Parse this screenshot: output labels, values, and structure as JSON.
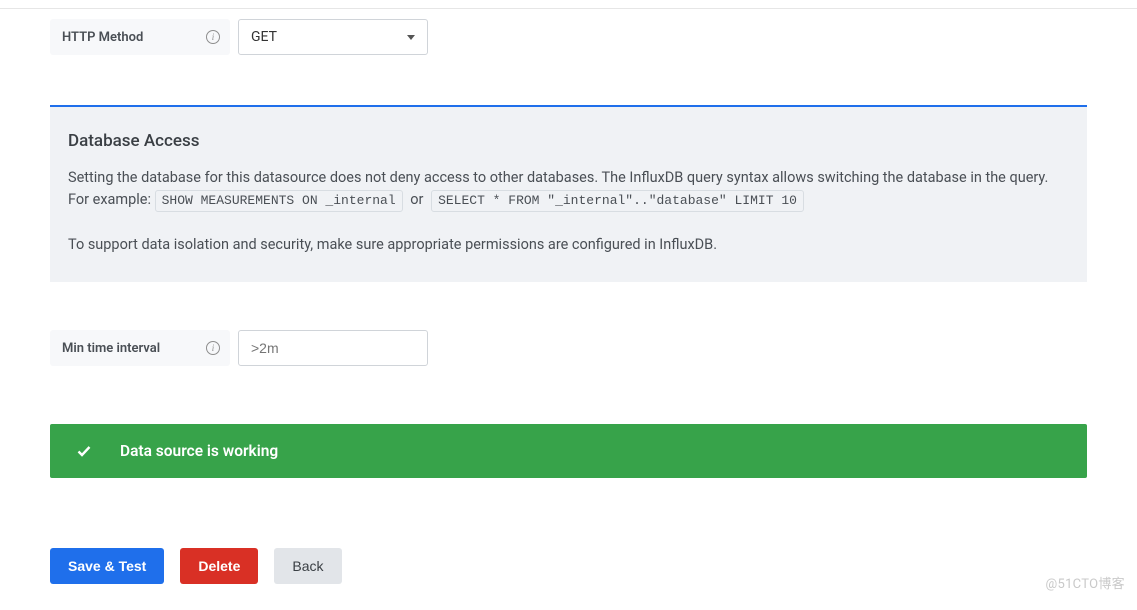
{
  "httpMethod": {
    "label": "HTTP Method",
    "value": "GET"
  },
  "dbAccess": {
    "title": "Database Access",
    "para1_a": "Setting the database for this datasource does not deny access to other databases. The InfluxDB query syntax allows switching the database in the query. For example: ",
    "code1": "SHOW MEASUREMENTS ON _internal",
    "or": "or",
    "code2": "SELECT * FROM \"_internal\"..\"database\" LIMIT 10",
    "para2": "To support data isolation and security, make sure appropriate permissions are configured in InfluxDB."
  },
  "minInterval": {
    "label": "Min time interval",
    "placeholder": ">2m",
    "value": ""
  },
  "alert": {
    "text": "Data source is working"
  },
  "buttons": {
    "saveTest": "Save & Test",
    "delete": "Delete",
    "back": "Back"
  },
  "watermark": "@51CTO博客"
}
